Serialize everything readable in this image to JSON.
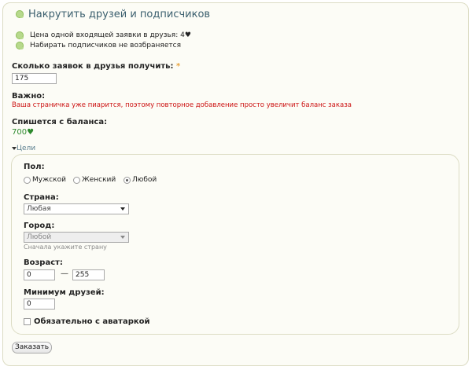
{
  "header": {
    "title": "Накрутить друзей и подписчиков"
  },
  "info": {
    "price_line": "Цена одной входящей заявки в друзья: 4♥",
    "followers_line": "Набирать подписчиков не возбраняется"
  },
  "requests": {
    "label": "Сколько заявок в друзья получить:",
    "required_mark": "*",
    "value": "175"
  },
  "important": {
    "label": "Важно:",
    "text": "Ваша страничка уже пиарится, поэтому повторное добавление просто увеличит баланс заказа"
  },
  "balance": {
    "label": "Спишется с баланса:",
    "value": "700♥"
  },
  "targets": {
    "toggle_label": "Цели",
    "gender": {
      "label": "Пол:",
      "options": [
        "Мужской",
        "Женский",
        "Любой"
      ],
      "selected": "Любой"
    },
    "country": {
      "label": "Страна:",
      "selected": "Любая"
    },
    "city": {
      "label": "Город:",
      "selected": "Любой",
      "hint": "Сначала укажите страну"
    },
    "age": {
      "label": "Возраст:",
      "from": "0",
      "separator": "—",
      "to": "255"
    },
    "min_friends": {
      "label": "Минимум друзей:",
      "value": "0"
    },
    "avatar": {
      "label": "Обязательно с аватаркой",
      "checked": false
    }
  },
  "submit": {
    "label": "Заказать"
  },
  "colors": {
    "accent": "#3b5f6e",
    "warning": "#cc1111",
    "balance": "#2e8a2e"
  }
}
